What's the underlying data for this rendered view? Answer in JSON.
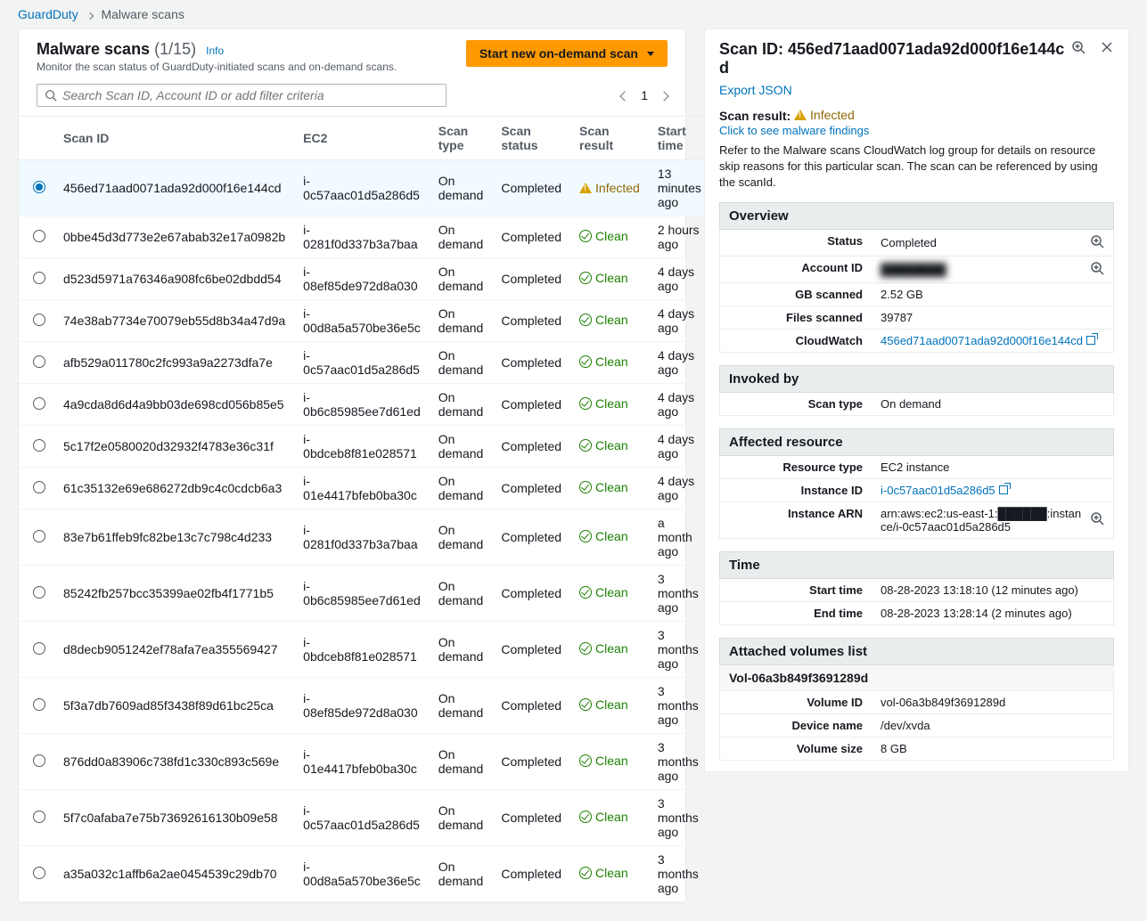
{
  "breadcrumbs": {
    "parent": "GuardDuty",
    "current": "Malware scans"
  },
  "header": {
    "title": "Malware scans",
    "count": "(1/15)",
    "info": "Info",
    "subtitle": "Monitor the scan status of GuardDuty-initiated scans and on-demand scans.",
    "start_btn": "Start new on-demand scan"
  },
  "search": {
    "placeholder": "Search Scan ID, Account ID or add filter criteria"
  },
  "pager": {
    "page": "1"
  },
  "columns": {
    "c1": "Scan ID",
    "c2": "EC2",
    "c3": "Scan type",
    "c4": "Scan status",
    "c5": "Scan result",
    "c6": "Start time"
  },
  "rows": [
    {
      "sel": true,
      "scan_id": "456ed71aad0071ada92d000f16e144cd",
      "ec2": "i-0c57aac01d5a286d5",
      "type": "On demand",
      "status": "Completed",
      "result": "Infected",
      "start": "13 minutes ago"
    },
    {
      "sel": false,
      "scan_id": "0bbe45d3d773e2e67abab32e17a0982b",
      "ec2": "i-0281f0d337b3a7baa",
      "type": "On demand",
      "status": "Completed",
      "result": "Clean",
      "start": "2 hours ago"
    },
    {
      "sel": false,
      "scan_id": "d523d5971a76346a908fc6be02dbdd54",
      "ec2": "i-08ef85de972d8a030",
      "type": "On demand",
      "status": "Completed",
      "result": "Clean",
      "start": "4 days ago"
    },
    {
      "sel": false,
      "scan_id": "74e38ab7734e70079eb55d8b34a47d9a",
      "ec2": "i-00d8a5a570be36e5c",
      "type": "On demand",
      "status": "Completed",
      "result": "Clean",
      "start": "4 days ago"
    },
    {
      "sel": false,
      "scan_id": "afb529a011780c2fc993a9a2273dfa7e",
      "ec2": "i-0c57aac01d5a286d5",
      "type": "On demand",
      "status": "Completed",
      "result": "Clean",
      "start": "4 days ago"
    },
    {
      "sel": false,
      "scan_id": "4a9cda8d6d4a9bb03de698cd056b85e5",
      "ec2": "i-0b6c85985ee7d61ed",
      "type": "On demand",
      "status": "Completed",
      "result": "Clean",
      "start": "4 days ago"
    },
    {
      "sel": false,
      "scan_id": "5c17f2e0580020d32932f4783e36c31f",
      "ec2": "i-0bdceb8f81e028571",
      "type": "On demand",
      "status": "Completed",
      "result": "Clean",
      "start": "4 days ago"
    },
    {
      "sel": false,
      "scan_id": "61c35132e69e686272db9c4c0cdcb6a3",
      "ec2": "i-01e4417bfeb0ba30c",
      "type": "On demand",
      "status": "Completed",
      "result": "Clean",
      "start": "4 days ago"
    },
    {
      "sel": false,
      "scan_id": "83e7b61ffeb9fc82be13c7c798c4d233",
      "ec2": "i-0281f0d337b3a7baa",
      "type": "On demand",
      "status": "Completed",
      "result": "Clean",
      "start": "a month ago"
    },
    {
      "sel": false,
      "scan_id": "85242fb257bcc35399ae02fb4f1771b5",
      "ec2": "i-0b6c85985ee7d61ed",
      "type": "On demand",
      "status": "Completed",
      "result": "Clean",
      "start": "3 months ago"
    },
    {
      "sel": false,
      "scan_id": "d8decb9051242ef78afa7ea355569427",
      "ec2": "i-0bdceb8f81e028571",
      "type": "On demand",
      "status": "Completed",
      "result": "Clean",
      "start": "3 months ago"
    },
    {
      "sel": false,
      "scan_id": "5f3a7db7609ad85f3438f89d61bc25ca",
      "ec2": "i-08ef85de972d8a030",
      "type": "On demand",
      "status": "Completed",
      "result": "Clean",
      "start": "3 months ago"
    },
    {
      "sel": false,
      "scan_id": "876dd0a83906c738fd1c330c893c569e",
      "ec2": "i-01e4417bfeb0ba30c",
      "type": "On demand",
      "status": "Completed",
      "result": "Clean",
      "start": "3 months ago"
    },
    {
      "sel": false,
      "scan_id": "5f7c0afaba7e75b73692616130b09e58",
      "ec2": "i-0c57aac01d5a286d5",
      "type": "On demand",
      "status": "Completed",
      "result": "Clean",
      "start": "3 months ago"
    },
    {
      "sel": false,
      "scan_id": "a35a032c1affb6a2ae0454539c29db70",
      "ec2": "i-00d8a5a570be36e5c",
      "type": "On demand",
      "status": "Completed",
      "result": "Clean",
      "start": "3 months ago"
    }
  ],
  "detail": {
    "title": "Scan ID: 456ed71aad0071ada92d000f16e144cd",
    "export": "Export JSON",
    "scan_result_label": "Scan result:",
    "scan_result": "Infected",
    "findings_link": "Click to see malware findings",
    "note": "Refer to the Malware scans CloudWatch log group for details on resource skip reasons for this particular scan. The scan can be referenced by using the scanId.",
    "overview": {
      "heading": "Overview",
      "status_k": "Status",
      "status_v": "Completed",
      "account_k": "Account ID",
      "account_v": "████████",
      "gb_k": "GB scanned",
      "gb_v": "2.52 GB",
      "files_k": "Files scanned",
      "files_v": "39787",
      "cw_k": "CloudWatch",
      "cw_v": "456ed71aad0071ada92d000f16e144cd"
    },
    "invoked": {
      "heading": "Invoked by",
      "type_k": "Scan type",
      "type_v": "On demand"
    },
    "affected": {
      "heading": "Affected resource",
      "rtype_k": "Resource type",
      "rtype_v": "EC2 instance",
      "iid_k": "Instance ID",
      "iid_v": "i-0c57aac01d5a286d5",
      "arn_k": "Instance ARN",
      "arn_v": "arn:aws:ec2:us-east-1:██████:instance/i-0c57aac01d5a286d5"
    },
    "time": {
      "heading": "Time",
      "start_k": "Start time",
      "start_v": "08-28-2023 13:18:10 (12 minutes ago)",
      "end_k": "End time",
      "end_v": "08-28-2023 13:28:14 (2 minutes ago)"
    },
    "volumes": {
      "heading": "Attached volumes list",
      "vol_name": "Vol-06a3b849f3691289d",
      "vid_k": "Volume ID",
      "vid_v": "vol-06a3b849f3691289d",
      "dev_k": "Device name",
      "dev_v": "/dev/xvda",
      "size_k": "Volume size",
      "size_v": "8 GB"
    }
  }
}
